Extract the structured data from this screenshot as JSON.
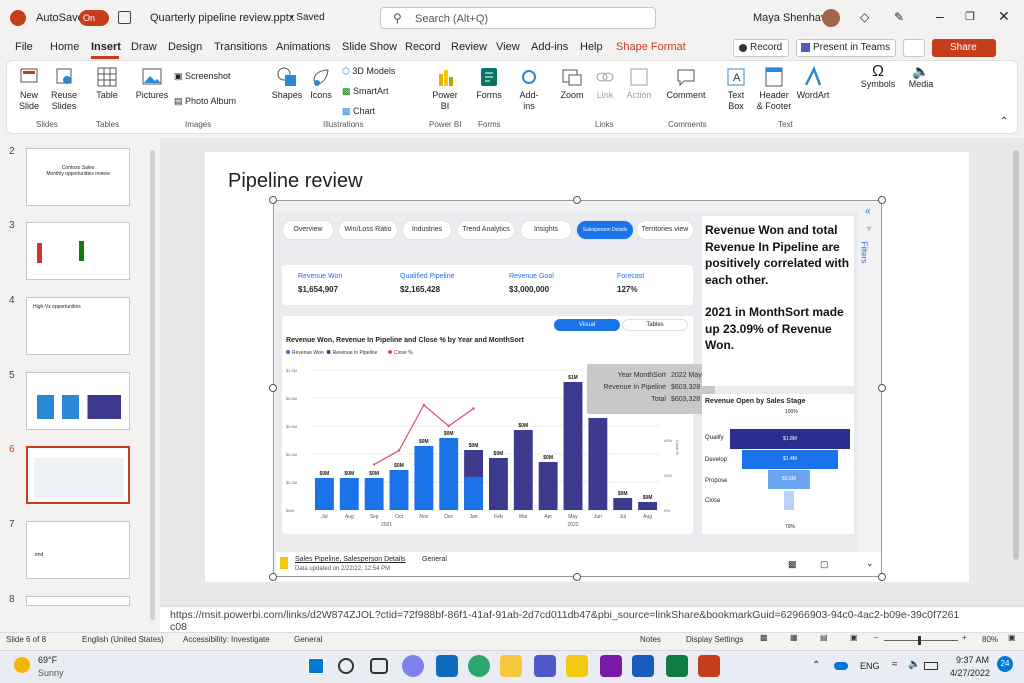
{
  "titlebar": {
    "autosave": "AutoSave",
    "toggle": "On",
    "filename": "Quarterly pipeline review.pptx",
    "saved": "• Saved",
    "search": "Search (Alt+Q)",
    "user": "Maya Shenhav"
  },
  "tabs": [
    "File",
    "Home",
    "Insert",
    "Draw",
    "Design",
    "Transitions",
    "Animations",
    "Slide Show",
    "Record",
    "Review",
    "View",
    "Add-ins",
    "Help",
    "Shape Format"
  ],
  "ribbon_right": {
    "record": "Record",
    "present": "Present in Teams",
    "share": "Share"
  },
  "ribbon": {
    "new_slide": "New\nSlide",
    "reuse": "Reuse\nSlides",
    "table": "Table",
    "pictures": "Pictures",
    "screenshot": "Screenshot",
    "photo_album": "Photo Album",
    "shapes": "Shapes",
    "icons": "Icons",
    "models": "3D Models",
    "smartart": "SmartArt",
    "chart": "Chart",
    "powerbi": "Power\nBI",
    "forms": "Forms",
    "addins": "Add-\nins",
    "zoom": "Zoom",
    "link": "Link",
    "action": "Action",
    "comment": "Comment",
    "textbox": "Text\nBox",
    "header": "Header\n& Footer",
    "wordart": "WordArt",
    "symbols": "Symbols",
    "media": "Media",
    "groups": [
      "Slides",
      "Tables",
      "Images",
      "Illustrations",
      "Power BI",
      "Forms",
      "Links",
      "Comments",
      "Text"
    ]
  },
  "thumbs": [
    "2",
    "3",
    "4",
    "5",
    "6",
    "7",
    "8"
  ],
  "thumb_text": {
    "t2a": "Contoso Sales",
    "t2b": "Monthly opportunities review",
    "t4": "High-Vz opportunities",
    "t7": "end"
  },
  "slide": {
    "title": "Pipeline review"
  },
  "pbi": {
    "tabs": [
      "Overview",
      "Win/Loss Ratio",
      "Industries",
      "Trend Analytics",
      "Insights",
      "Salesperson Details",
      "Territories view"
    ],
    "kpis": [
      {
        "label": "Revenue Won",
        "value": "$1,654,907"
      },
      {
        "label": "Qualified Pipeline",
        "value": "$2,165,428"
      },
      {
        "label": "Revenue Goal",
        "value": "$3,000,000"
      },
      {
        "label": "Forecast",
        "value": "127%"
      }
    ],
    "toggle": [
      "Visual",
      "Tables"
    ],
    "insight1": "Revenue Won and total Revenue In Pipeline are positively correlated with each other.",
    "insight2": "2021 in MonthSort  made up 23.09% of Revenue Won.",
    "filters": "Filters",
    "tooltip": [
      [
        "Year MonthSort",
        "2022 May"
      ],
      [
        "Revenue In Pipeline",
        "$603,328"
      ],
      [
        "Total",
        "$603,328"
      ]
    ],
    "funnel_title": "Revenue Open by Sales Stage",
    "funnel_stages": [
      "Qualify",
      "Develop",
      "Propose",
      "Close"
    ],
    "funnel_vals": [
      "$1.8M",
      "$1.4M",
      "$0.6M",
      ""
    ],
    "funnel_pct": [
      "100%",
      "70%"
    ],
    "footer_link": "Sales Pipeline, Salesperson Details",
    "footer_sep": "General",
    "footer_date": "Data updated on 2/22/22, 12:54 PM"
  },
  "chart_data": {
    "type": "bar",
    "title": "Revenue Won, Revenue In Pipeline and Close % by Year and MonthSort",
    "legend": [
      "Revenue Won",
      "Revenue In Pipeline",
      "Close %"
    ],
    "categories": [
      "Jul",
      "Aug",
      "Sep",
      "Oct",
      "Nov",
      "Dec",
      "Jan",
      "Feb",
      "Mar",
      "Apr",
      "May",
      "Jun",
      "Jul",
      "Aug"
    ],
    "years": [
      "2021",
      "2022"
    ],
    "values": [
      0.8,
      0.8,
      0.8,
      1.0,
      1.6,
      1.8,
      1.5,
      1.3,
      2.0,
      1.2,
      3.2,
      2.3,
      0.3,
      0.2
    ],
    "bar_labels": [
      "$0M",
      "$0M",
      "$0M",
      "$0M",
      "$0M",
      "$0M",
      "$0M",
      "$0M",
      "$0M",
      "$0M",
      "$1M",
      "",
      "$0M",
      "$0M"
    ],
    "close_pct": [
      null,
      null,
      26,
      34,
      60,
      48,
      58,
      null,
      null,
      null,
      null,
      null,
      null,
      null
    ],
    "yticks": [
      "$0M",
      "$0.2M",
      "$0.4M",
      "$0.6M",
      "$0.8M",
      "$1.0M"
    ],
    "y2ticks": [
      "0%",
      "20%",
      "40%",
      "60%",
      "80%"
    ],
    "y2label": "Close %",
    "colors": {
      "won": "#1a73e8",
      "pipeline": "#3b3a8c",
      "close": "#e04a6f"
    }
  },
  "url": "https://msit.powerbi.com/links/d2W874ZJOL?ctid=72f988bf-86f1-41af-91ab-2d7cd011db47&pbi_source=linkShare&bookmarkGuid=62966903-94c0-4ac2-b09e-39c0f7261c08",
  "status": {
    "slide": "Slide 6 of 8",
    "lang": "English (United States)",
    "access": "Accessibility: Investigate",
    "general": "General",
    "notes": "Notes",
    "display": "Display Settings",
    "zoom": "80%"
  },
  "taskbar": {
    "temp": "69°F",
    "weather": "Sunny",
    "lang": "ENG",
    "time": "9:37 AM",
    "date": "4/27/2022",
    "badge": "24"
  }
}
